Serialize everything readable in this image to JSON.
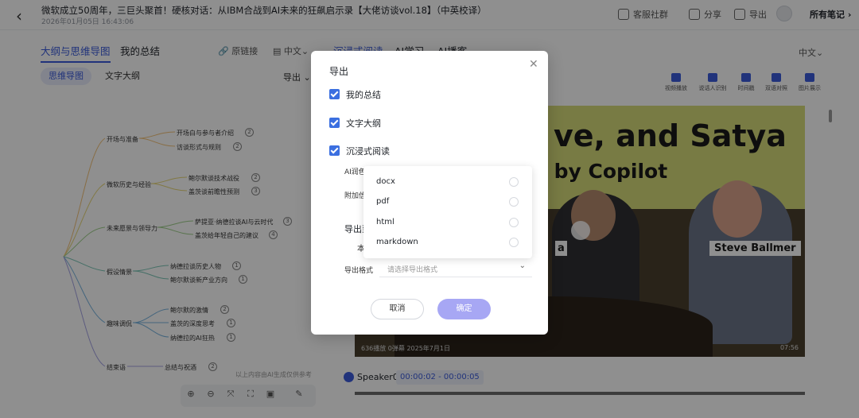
{
  "header": {
    "title": "微软成立50周年，三巨头聚首！硬核对话：从IBM合战到AI未来的狂飙启示录【大佬访谈vol.18】（中英校译）",
    "timestamp": "2026年01月05日 16:43:06",
    "community": "客服社群",
    "share": "分享",
    "export": "导出",
    "all_notes": "所有笔记"
  },
  "left": {
    "tab_outline": "大纲与思维导图",
    "tab_summary": "我的总结",
    "link": "原链接",
    "lang": "中文",
    "pill_mindmap": "思维导图",
    "pill_text_outline": "文字大纲",
    "export_dd": "导出",
    "disclaimer": "以上内容由AI生成仅供参考",
    "mindmap": [
      {
        "label": "开场与准备",
        "children": [
          {
            "label": "开场白与参与者介绍",
            "n": "2"
          },
          {
            "label": "访谈形式与规则",
            "n": "2"
          }
        ]
      },
      {
        "label": "微软历史与经验",
        "children": [
          {
            "label": "鲍尔默谈技术战役",
            "n": "2"
          },
          {
            "label": "盖茨谈前瞻性预测",
            "n": "3"
          }
        ]
      },
      {
        "label": "未来愿景与领导力",
        "children": [
          {
            "label": "萨提亚·纳德拉谈AI与云时代",
            "n": "3"
          },
          {
            "label": "盖茨给年轻自己的建议",
            "n": "4"
          }
        ]
      },
      {
        "label": "假设情景",
        "children": [
          {
            "label": "纳德拉谈历史人物",
            "n": "1"
          },
          {
            "label": "鲍尔默谈新产业方向",
            "n": "1"
          }
        ]
      },
      {
        "label": "趣味调侃",
        "children": [
          {
            "label": "鲍尔默的激情",
            "n": "2"
          },
          {
            "label": "盖茨的深度思考",
            "n": "1"
          },
          {
            "label": "纳德拉的AI狂热",
            "n": "1"
          }
        ]
      },
      {
        "label": "结束语",
        "children": [
          {
            "label": "总结与祝酒",
            "n": "2"
          }
        ]
      }
    ]
  },
  "right": {
    "tab_immersive": "沉浸式阅读",
    "tab_ai_learn": "AI学习",
    "tab_ai_podcast": "AI播客",
    "lang": "中文",
    "tools": [
      "视频播放",
      "说话人识别",
      "时间戳",
      "双语对照",
      "图片展示"
    ],
    "video": {
      "banner_line1": "ve, and Satya",
      "banner_line2": "d by Copilot",
      "nametag_left": "a",
      "nametag_right": "Steve Ballmer",
      "stats": "636播放 0弹幕 2025年7月1日",
      "duration": "07:56"
    },
    "speaker": "Speaker0",
    "time_range": "00:00:02 - 00:00:05"
  },
  "dialog": {
    "title": "导出",
    "close_icon": "close-icon",
    "checks": [
      "我的总结",
      "文字大纲",
      "沉浸式阅读"
    ],
    "ai_label": "AI润色",
    "attach_label": "附加信",
    "export_section": "导出到",
    "local_label": "本",
    "format_label": "导出格式",
    "format_placeholder": "请选择导出格式",
    "options": [
      "docx",
      "pdf",
      "html",
      "markdown"
    ],
    "cancel": "取消",
    "confirm": "确定"
  }
}
